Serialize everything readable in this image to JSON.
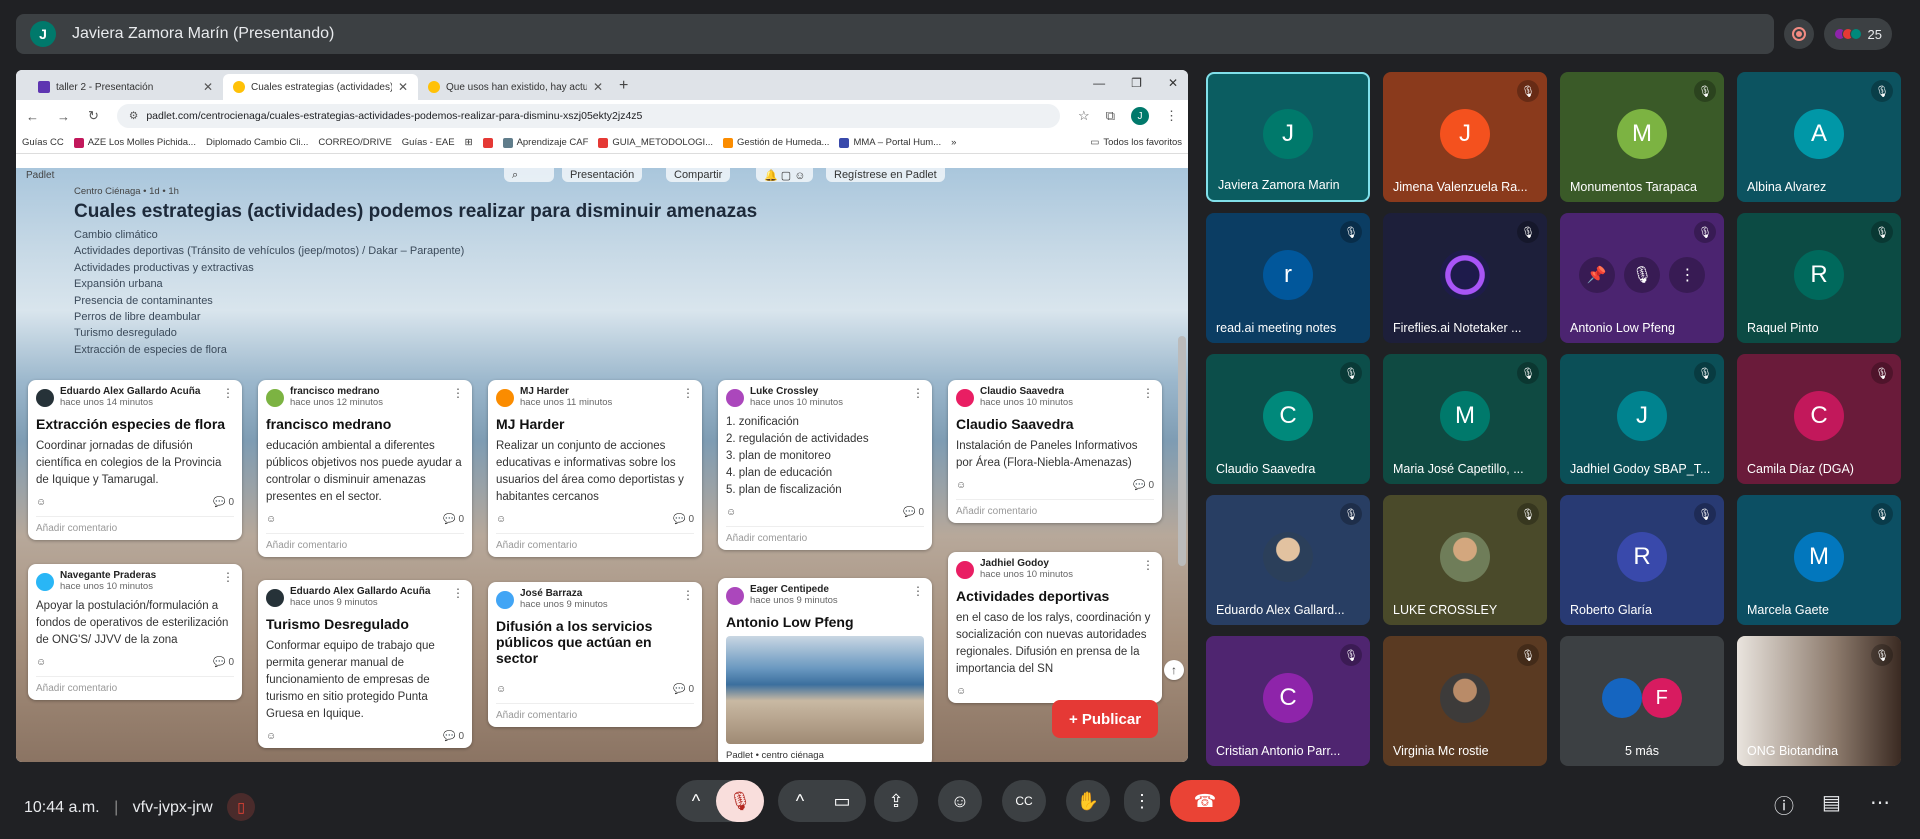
{
  "meeting": {
    "presenter_initial": "J",
    "presenter_title": "Javiera Zamora Marín (Presentando)",
    "participant_count": "25",
    "time": "10:44 a.m.",
    "code": "vfv-jvpx-jrw"
  },
  "browser": {
    "tabs": [
      {
        "label": "taller 2 - Presentación",
        "close": "✕"
      },
      {
        "label": "Cuales estrategias (actividades)",
        "close": "✕"
      },
      {
        "label": "Que usos han existido, hay actu",
        "close": "✕"
      }
    ],
    "new_tab": "+",
    "url": "padlet.com/centrocienaga/cuales-estrategias-actividades-podemos-realizar-para-disminu-xszj05ekty2jz4z5",
    "profile_initial": "J",
    "bookmarks": [
      "Guías CC",
      "AZE Los Molles Pichida...",
      "Diplomado Cambio Cli...",
      "CORREO/DRIVE",
      "Guías - EAE",
      "Aprendizaje CAF",
      "GUIA_METODOLOGI...",
      "Gestión de Humeda...",
      "MMA – Portal Hum..."
    ],
    "bookmarks_more": "»",
    "all_favorites": "Todos los favoritos"
  },
  "padlet": {
    "brand": "Padlet",
    "btn_presentation": "Presentación",
    "btn_share": "Compartir",
    "btn_register": "Regístrese en Padlet",
    "meta": "Centro Ciénaga • 1d • 1h",
    "title": "Cuales estrategias (actividades) podemos realizar para disminuir amenazas",
    "threats": [
      "Cambio climático",
      "Actividades deportivas (Tránsito de vehículos (jeep/motos) / Dakar – Parapente)",
      "Actividades productivas y extractivas",
      "Expansión urbana",
      "Presencia de contaminantes",
      "Perros de libre deambular",
      "Turismo desregulado",
      "Extracción de especies de flora"
    ],
    "add_comment": "Añadir comentario",
    "publish": "+ Publicar",
    "cards": [
      {
        "author": "Eduardo Alex Gallardo Acuña",
        "time": "hace unos 14 minutos",
        "title": "Extracción especies de flora",
        "body": "Coordinar jornadas de difusión científica en colegios de la Provincia de Iquique y Tamarugal.",
        "comments": "0"
      },
      {
        "author": "francisco medrano",
        "time": "hace unos 12 minutos",
        "title": "francisco medrano",
        "body": "educación ambiental a diferentes públicos objetivos nos puede ayudar a controlar o disminuir amenazas presentes en el sector.",
        "comments": "0"
      },
      {
        "author": "MJ Harder",
        "time": "hace unos 11 minutos",
        "title": "MJ Harder",
        "body": "Realizar un conjunto de acciones educativas e informativas sobre los usuarios del área como deportistas y habitantes cercanos",
        "comments": "0"
      },
      {
        "author": "Luke Crossley",
        "time": "hace unos 10 minutos",
        "title": "",
        "body": "1. zonificación\n2. regulación de actividades\n3. plan de monitoreo\n4. plan de educación\n5. plan de fiscalización",
        "comments": "0"
      },
      {
        "author": "Claudio Saavedra",
        "time": "hace unos 10 minutos",
        "title": "Claudio Saavedra",
        "body": "Instalación de Paneles Informativos por Área (Flora-Niebla-Amenazas)",
        "comments": "0"
      },
      {
        "author": "Navegante Praderas",
        "time": "hace unos 10 minutos",
        "title": "",
        "body": "Apoyar la postulación/formulación a fondos de operativos de esterilización de ONG'S/ JJVV de la zona",
        "comments": "0"
      },
      {
        "author": "Eduardo Alex Gallardo Acuña",
        "time": "hace unos 9 minutos",
        "title": "Turismo Desregulado",
        "body": "Conformar equipo de trabajo que permita  generar manual de funcionamiento de empresas de turismo en sitio protegido Punta Gruesa en Iquique.",
        "comments": "0"
      },
      {
        "author": "José Barraza",
        "time": "hace unos 9 minutos",
        "title": "Difusión  a los servicios públicos que actúan en sector",
        "body": "",
        "comments": "0"
      },
      {
        "author": "Eager Centipede",
        "time": "hace unos 9 minutos",
        "title": "Antonio Low Pfeng",
        "body": "",
        "comments": "",
        "attribution": "Padlet • centro ciénaga"
      },
      {
        "author": "Jadhiel Godoy",
        "time": "hace unos 10 minutos",
        "title": "Actividades deportivas",
        "body": "en el caso de los ralys, coordinación y socialización con nuevas autoridades regionales. Difusión en prensa de la importancia del SN",
        "comments": ""
      }
    ]
  },
  "participants": [
    {
      "initial": "J",
      "name": "Javiera Zamora Marin",
      "bg": "#00796b",
      "tile": "#0b5d61",
      "muted": false
    },
    {
      "initial": "J",
      "name": "Jimena Valenzuela Ra...",
      "bg": "#f4511e",
      "tile": "#8a3a1c",
      "muted": true
    },
    {
      "initial": "M",
      "name": "Monumentos Tarapaca",
      "bg": "#7cb342",
      "tile": "#3a5a28",
      "muted": true
    },
    {
      "initial": "A",
      "name": "Albina Alvarez",
      "bg": "#0097a7",
      "tile": "#0c5360",
      "muted": true
    },
    {
      "initial": "r",
      "name": "read.ai meeting notes",
      "bg": "#01579b",
      "tile": "#0b3d63",
      "muted": true
    },
    {
      "initial": "",
      "name": "Fireflies.ai Notetaker ...",
      "bg": "#5c1e8a",
      "tile": "#1d1f3a",
      "muted": true
    },
    {
      "initial": "",
      "name": "Antonio Low Pfeng",
      "bg": "#6a1b9a",
      "tile": "#4b2470",
      "muted": true
    },
    {
      "initial": "R",
      "name": "Raquel Pinto",
      "bg": "#00695c",
      "tile": "#0c4b44",
      "muted": true
    },
    {
      "initial": "C",
      "name": "Claudio Saavedra",
      "bg": "#00897b",
      "tile": "#0c4e4a",
      "muted": true
    },
    {
      "initial": "M",
      "name": "Maria José Capetillo, ...",
      "bg": "#00796b",
      "tile": "#0f4a42",
      "muted": true
    },
    {
      "initial": "J",
      "name": "Jadhiel Godoy SBAP_T...",
      "bg": "#00838f",
      "tile": "#0b4f57",
      "muted": true
    },
    {
      "initial": "C",
      "name": "Camila Díaz (DGA)",
      "bg": "#c2185b",
      "tile": "#6a1b3a",
      "muted": true
    },
    {
      "initial": "",
      "name": "Eduardo Alex Gallard...",
      "bg": "#2b3f5a",
      "tile": "#283e63",
      "muted": true
    },
    {
      "initial": "",
      "name": "LUKE CROSSLEY",
      "bg": "#6f7d59",
      "tile": "#4a4a2a",
      "muted": true
    },
    {
      "initial": "R",
      "name": "Roberto Glaría",
      "bg": "#3949ab",
      "tile": "#283a73",
      "muted": true
    },
    {
      "initial": "M",
      "name": "Marcela Gaete",
      "bg": "#0277bd",
      "tile": "#0c4f63",
      "muted": true
    },
    {
      "initial": "C",
      "name": "Cristian Antonio Parr...",
      "bg": "#8e24aa",
      "tile": "#4f2570",
      "muted": true
    },
    {
      "initial": "",
      "name": "Virginia Mc rostie",
      "bg": "#3d3b3a",
      "tile": "#5a3a22",
      "muted": true
    },
    {
      "initial": "F",
      "name": "5 más",
      "bg": "#d81b60",
      "tile": "#3c4043",
      "muted": false
    },
    {
      "initial": "",
      "name": "ONG Biotandina",
      "bg": "#5d4037",
      "tile": "#6d5a4e",
      "muted": true
    }
  ],
  "icons": {
    "mic_off": "mic-off-icon",
    "camera": "camera-icon",
    "present": "present-icon",
    "emoji": "emoji-icon",
    "captions": "captions-icon",
    "hand": "hand-icon",
    "more": "more-icon",
    "hangup": "hangup-icon",
    "info": "info-icon",
    "chat": "chat-icon",
    "activities": "activities-icon"
  },
  "colors": {
    "accent_red": "#ea4335",
    "publish_red": "#e53935",
    "selected_border": "#81e0ea"
  }
}
